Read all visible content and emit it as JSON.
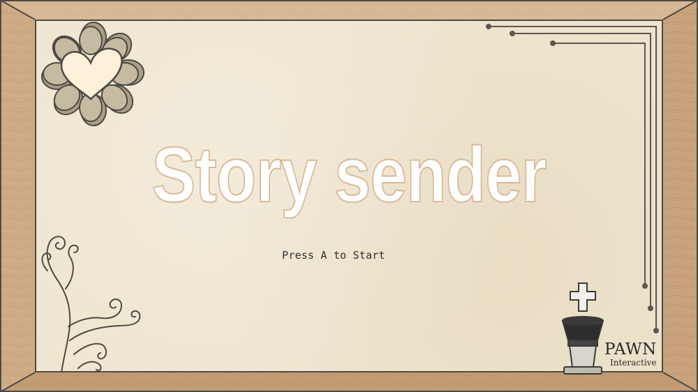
{
  "game": {
    "title": "Story sender",
    "prompt": "Press A to Start"
  },
  "logo": {
    "name_line1": "PAWN",
    "name_line2": "Interactive"
  },
  "icons": {
    "flower": "heart-flower-icon",
    "swirls": "swirl-vine-icon",
    "lines": "corner-lines-icon",
    "king": "chess-king-icon"
  },
  "colors": {
    "wood": "#c8a47c",
    "paper": "#efe5cf",
    "ink": "#4c4a44",
    "title_fill": "#ffffff",
    "title_outline": "#d9b896"
  }
}
